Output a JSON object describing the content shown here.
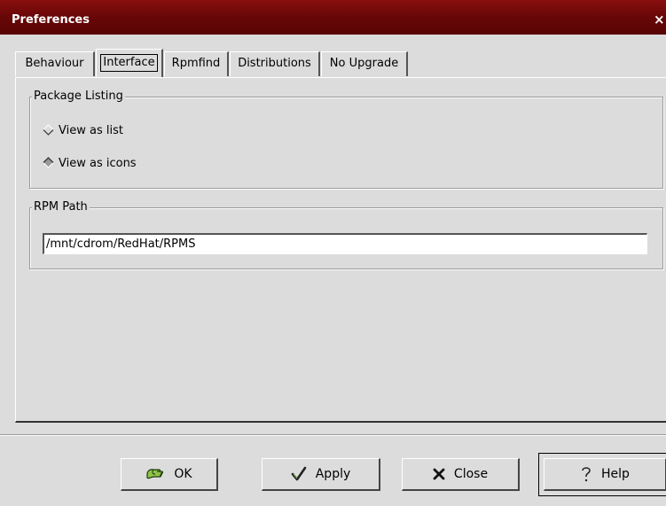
{
  "window": {
    "title": "Preferences",
    "close_glyph": "×"
  },
  "tabs": [
    {
      "label": "Behaviour",
      "active": false
    },
    {
      "label": "Interface",
      "active": true
    },
    {
      "label": "Rpmfind",
      "active": false
    },
    {
      "label": "Distributions",
      "active": false
    },
    {
      "label": "No Upgrade",
      "active": false
    }
  ],
  "package_listing": {
    "label": "Package Listing",
    "options": [
      {
        "label": "View as list",
        "selected": false
      },
      {
        "label": "View as icons",
        "selected": true
      }
    ]
  },
  "rpm_path": {
    "label": "RPM Path",
    "value": "/mnt/cdrom/RedHat/RPMS"
  },
  "buttons": {
    "ok": {
      "label": "OK",
      "icon": "ok-hand-icon"
    },
    "apply": {
      "label": "Apply",
      "icon": "checkmark-icon"
    },
    "close": {
      "label": "Close",
      "icon": "x-icon"
    },
    "help": {
      "label": "Help",
      "icon": "question-icon"
    }
  },
  "colors": {
    "titlebar": "#6a0707",
    "background": "#dcdcdc"
  }
}
